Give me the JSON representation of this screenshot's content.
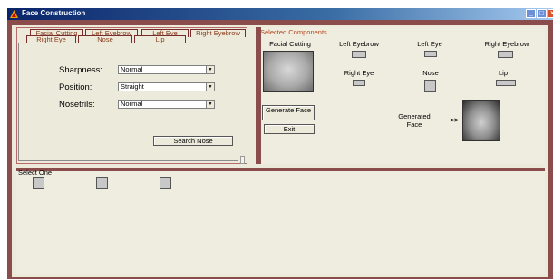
{
  "window": {
    "title": "Face Construction"
  },
  "tabs": {
    "row1": [
      "Facial Cutting",
      "Left Eyebrow",
      "Left Eye",
      "Right Eyebrow"
    ],
    "row2": [
      "Right Eye",
      "Nose",
      "Lip"
    ],
    "active": "Nose"
  },
  "nose_form": {
    "sharpness": {
      "label": "Sharpness:",
      "value": "Normal"
    },
    "position": {
      "label": "Position:",
      "value": "Straight"
    },
    "nostrils": {
      "label": "Nosetrils:",
      "value": "Normal"
    },
    "search_button": "Search Nose"
  },
  "selected": {
    "title": "Selected Components",
    "facial_cutting": "Facial Cutting",
    "left_eyebrow": "Left Eyebrow",
    "left_eye": "Left Eye",
    "right_eyebrow": "Right Eyebrow",
    "right_eye": "Right Eye",
    "nose": "Nose",
    "lip": "Lip",
    "generate_button": "Generate Face",
    "exit_button": "Exit",
    "generated_label": "Generated Face",
    "arrow": ">>"
  },
  "bottom": {
    "title": "Select One"
  },
  "colors": {
    "frame": "#8b4c4c",
    "tab_text": "#8a3a1a",
    "title_accent": "#b5451b"
  }
}
